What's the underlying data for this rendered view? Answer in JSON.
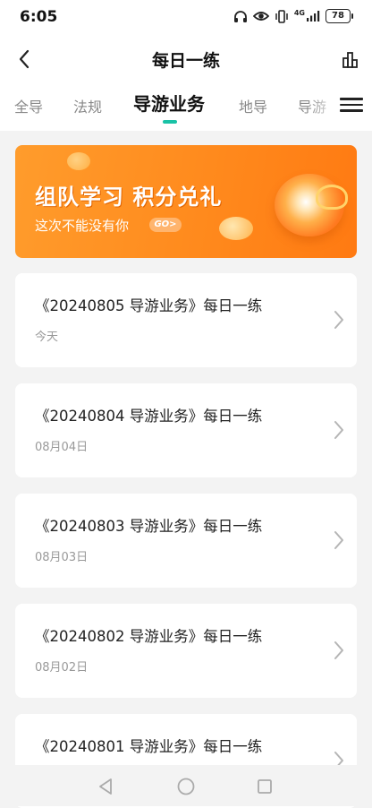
{
  "status": {
    "time": "6:05",
    "network": "4G",
    "battery": "78",
    "icons": [
      "headphones-icon",
      "eye-icon",
      "vibrate-icon",
      "signal-icon",
      "battery-icon"
    ]
  },
  "header": {
    "title": "每日一练",
    "back_icon": "chevron-left-icon",
    "stats_icon": "bar-chart-icon"
  },
  "tabs": [
    {
      "label": "全导",
      "active": false
    },
    {
      "label": "法规",
      "active": false
    },
    {
      "label": "导游业务",
      "active": true
    },
    {
      "label": "地导",
      "active": false
    },
    {
      "label": "导游",
      "active": false
    }
  ],
  "menu_icon": "hamburger-menu-icon",
  "banner": {
    "title": "组队学习 积分兑礼",
    "subtitle": "这次不能没有你",
    "badge": "GO>"
  },
  "practices": [
    {
      "title": "《20240805 导游业务》每日一练",
      "date": "今天"
    },
    {
      "title": "《20240804 导游业务》每日一练",
      "date": "08月04日"
    },
    {
      "title": "《20240803 导游业务》每日一练",
      "date": "08月03日"
    },
    {
      "title": "《20240802 导游业务》每日一练",
      "date": "08月02日"
    },
    {
      "title": "《20240801 导游业务》每日一练",
      "date": ""
    }
  ],
  "colors": {
    "accent": "#19c2a6",
    "banner_orange": "#ff8a1d",
    "background": "#f3f3f3"
  },
  "system_nav": [
    "back-triangle-icon",
    "home-circle-icon",
    "recents-square-icon"
  ]
}
